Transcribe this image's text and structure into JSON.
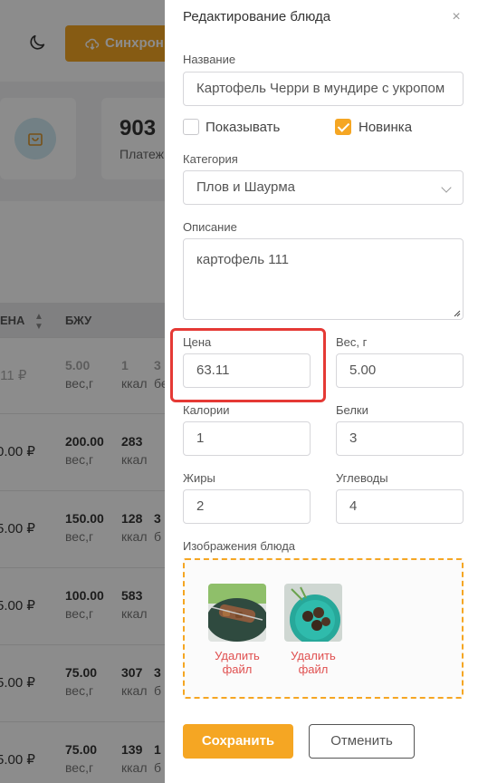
{
  "background": {
    "sync_label": "Синхрон",
    "stat_value": "903",
    "stat_label": "Платеж",
    "table_headers": [
      "ЕНА",
      "БЖУ"
    ],
    "rows": [
      {
        "price": ".11 ₽",
        "weight": "5.00",
        "weight_unit": "вес,г",
        "kcal": "1",
        "kcal_unit": "ккал",
        "extra": "3",
        "extra_unit": "бе"
      },
      {
        "price": "0.00 ₽",
        "weight": "200.00",
        "weight_unit": "вес,г",
        "kcal": "283",
        "kcal_unit": "ккал",
        "extra": "",
        "extra_unit": ""
      },
      {
        "price": "5.00 ₽",
        "weight": "150.00",
        "weight_unit": "вес,г",
        "kcal": "128",
        "kcal_unit": "ккал",
        "extra": "3",
        "extra_unit": "б"
      },
      {
        "price": "5.00 ₽",
        "weight": "100.00",
        "weight_unit": "вес,г",
        "kcal": "583",
        "kcal_unit": "ккал",
        "extra": "",
        "extra_unit": ""
      },
      {
        "price": "5.00 ₽",
        "weight": "75.00",
        "weight_unit": "вес,г",
        "kcal": "307",
        "kcal_unit": "ккал",
        "extra": "3",
        "extra_unit": "б"
      },
      {
        "price": "5.00 ₽",
        "weight": "75.00",
        "weight_unit": "вес,г",
        "kcal": "139",
        "kcal_unit": "ккал",
        "extra": "1",
        "extra_unit": "б"
      }
    ]
  },
  "drawer": {
    "title": "Редактирование блюда",
    "close_glyph": "×",
    "name_label": "Название",
    "name_value": "Картофель Черри в мундире с укропом",
    "show_label": "Показывать",
    "show_checked": false,
    "new_label": "Новинка",
    "new_checked": true,
    "category_label": "Категория",
    "category_value": "Плов и Шаурма",
    "description_label": "Описание",
    "description_value": "картофель 111",
    "price_label": "Цена",
    "price_value": "63.11",
    "weight_label": "Вес, г",
    "weight_value": "5.00",
    "calories_label": "Калории",
    "calories_value": "1",
    "protein_label": "Белки",
    "protein_value": "3",
    "fat_label": "Жиры",
    "fat_value": "2",
    "carbs_label": "Углеводы",
    "carbs_value": "4",
    "images_label": "Изображения блюда",
    "images": [
      {
        "delete_label": "Удалить файл"
      },
      {
        "delete_label": "Удалить файл"
      }
    ],
    "save_label": "Сохранить",
    "cancel_label": "Отменить"
  },
  "colors": {
    "accent": "#f5a623",
    "highlight": "#e53935",
    "delete_link": "#e05050"
  }
}
